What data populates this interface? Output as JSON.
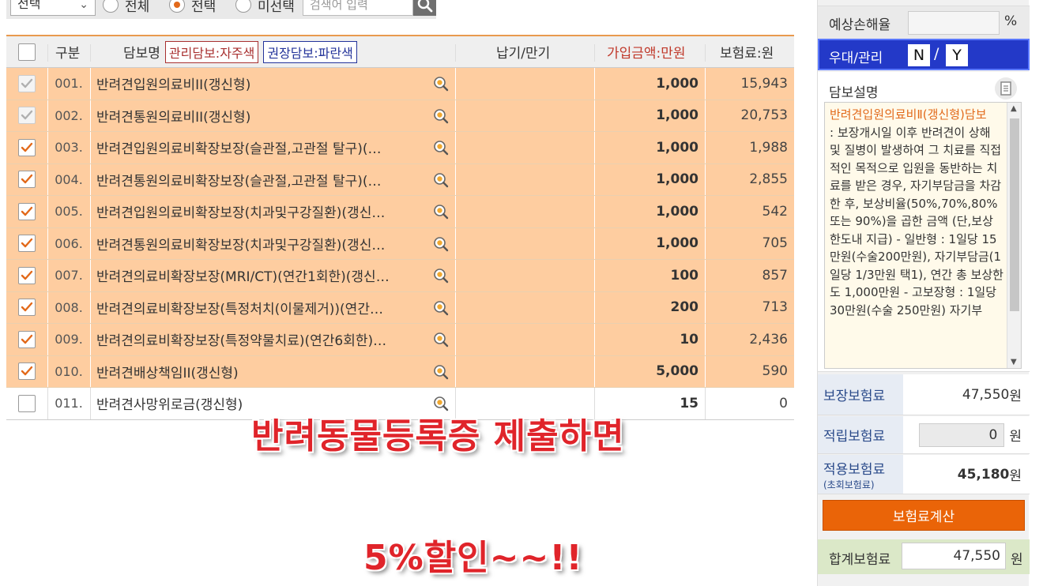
{
  "filter": {
    "select_value": "전택",
    "radios": [
      {
        "label": "전체",
        "checked": false
      },
      {
        "label": "전택",
        "checked": true
      },
      {
        "label": "미선택",
        "checked": false
      }
    ],
    "search_placeholder": "검색어 입력"
  },
  "table": {
    "headers": {
      "division": "구분",
      "name": "담보명",
      "tag_managed": "관리담보:자주색",
      "tag_recommended": "권장담보:파란색",
      "term": "납기/만기",
      "amount": "가입금액:만원",
      "premium": "보험료:원"
    },
    "rows": [
      {
        "no": "001.",
        "name": "반려견입원의료비II(갱신형)",
        "amount": "1,000",
        "premium": "15,943",
        "checked": true,
        "disabled": true
      },
      {
        "no": "002.",
        "name": "반려견통원의료비II(갱신형)",
        "amount": "1,000",
        "premium": "20,753",
        "checked": true,
        "disabled": true
      },
      {
        "no": "003.",
        "name": "반려견입원의료비확장보장(슬관절,고관절 탈구)(…",
        "amount": "1,000",
        "premium": "1,988",
        "checked": true,
        "disabled": false
      },
      {
        "no": "004.",
        "name": "반려견통원의료비확장보장(슬관절,고관절 탈구)(…",
        "amount": "1,000",
        "premium": "2,855",
        "checked": true,
        "disabled": false
      },
      {
        "no": "005.",
        "name": "반려견입원의료비확장보장(치과및구강질환)(갱신…",
        "amount": "1,000",
        "premium": "542",
        "checked": true,
        "disabled": false
      },
      {
        "no": "006.",
        "name": "반려견통원의료비확장보장(치과및구강질환)(갱신…",
        "amount": "1,000",
        "premium": "705",
        "checked": true,
        "disabled": false
      },
      {
        "no": "007.",
        "name": "반려견의료비확장보장(MRI/CT)(연간1회한)(갱신…",
        "amount": "100",
        "premium": "857",
        "checked": true,
        "disabled": false
      },
      {
        "no": "008.",
        "name": "반려견의료비확장보장(특정처치(이물제거))(연간…",
        "amount": "200",
        "premium": "713",
        "checked": true,
        "disabled": false
      },
      {
        "no": "009.",
        "name": "반려견의료비확장보장(특정약물치료)(연간6회한)…",
        "amount": "10",
        "premium": "2,436",
        "checked": true,
        "disabled": false
      },
      {
        "no": "010.",
        "name": "반려견배상책임II(갱신형)",
        "amount": "5,000",
        "premium": "590",
        "checked": true,
        "disabled": false
      },
      {
        "no": "011.",
        "name": "반려견사망위로금(갱신형)",
        "amount": "15",
        "premium": "0",
        "checked": false,
        "disabled": false
      }
    ]
  },
  "captions": {
    "line1": "반려동물등록증 제출하면",
    "line2": "5%할인~~!!"
  },
  "right": {
    "loss_label": "예상손해율",
    "loss_unit": "%",
    "pref_label": "우대/관리",
    "pref_n": "N",
    "pref_slash": "/",
    "pref_y": "Y",
    "desc_title": "담보설명",
    "desc_head": "반려견입원의료비Ⅱ(갱신형)담보",
    "desc_body": ": 보장개시일 이후 반려견이 상해 및 질병이 발생하여 그 치료를 직접적인 목적으로 입원을 동반하는 치료를 받은 경우, 자기부담금을 차감한 후, 보상비율(50%,70%,80% 또는 90%)을 곱한 금액 (단,보상한도내 지급) - 일반형 : 1일당 15만원(수술200만원), 자기부담금(1일당 1/3만원 택1), 연간 총 보상한도 1,000만원 - 고보장형 : 1일당 30만원(수술 250만원) 자기부",
    "sum_cover_label": "보장보험료",
    "sum_cover_value": "47,550",
    "sum_saving_label": "적립보험료",
    "sum_saving_value": "0",
    "sum_applied_label": "적용보험료",
    "sum_applied_sub": "(초회보험료)",
    "sum_applied_value": "45,180",
    "unit_won": "원",
    "calc_button": "보험료계산",
    "total_label": "합계보험료",
    "total_value": "47,550"
  },
  "colors": {
    "selected_row": "#fecda0",
    "accent_orange": "#ea6408",
    "pref_blue": "#2339c8",
    "caption_red": "#e0242a"
  }
}
